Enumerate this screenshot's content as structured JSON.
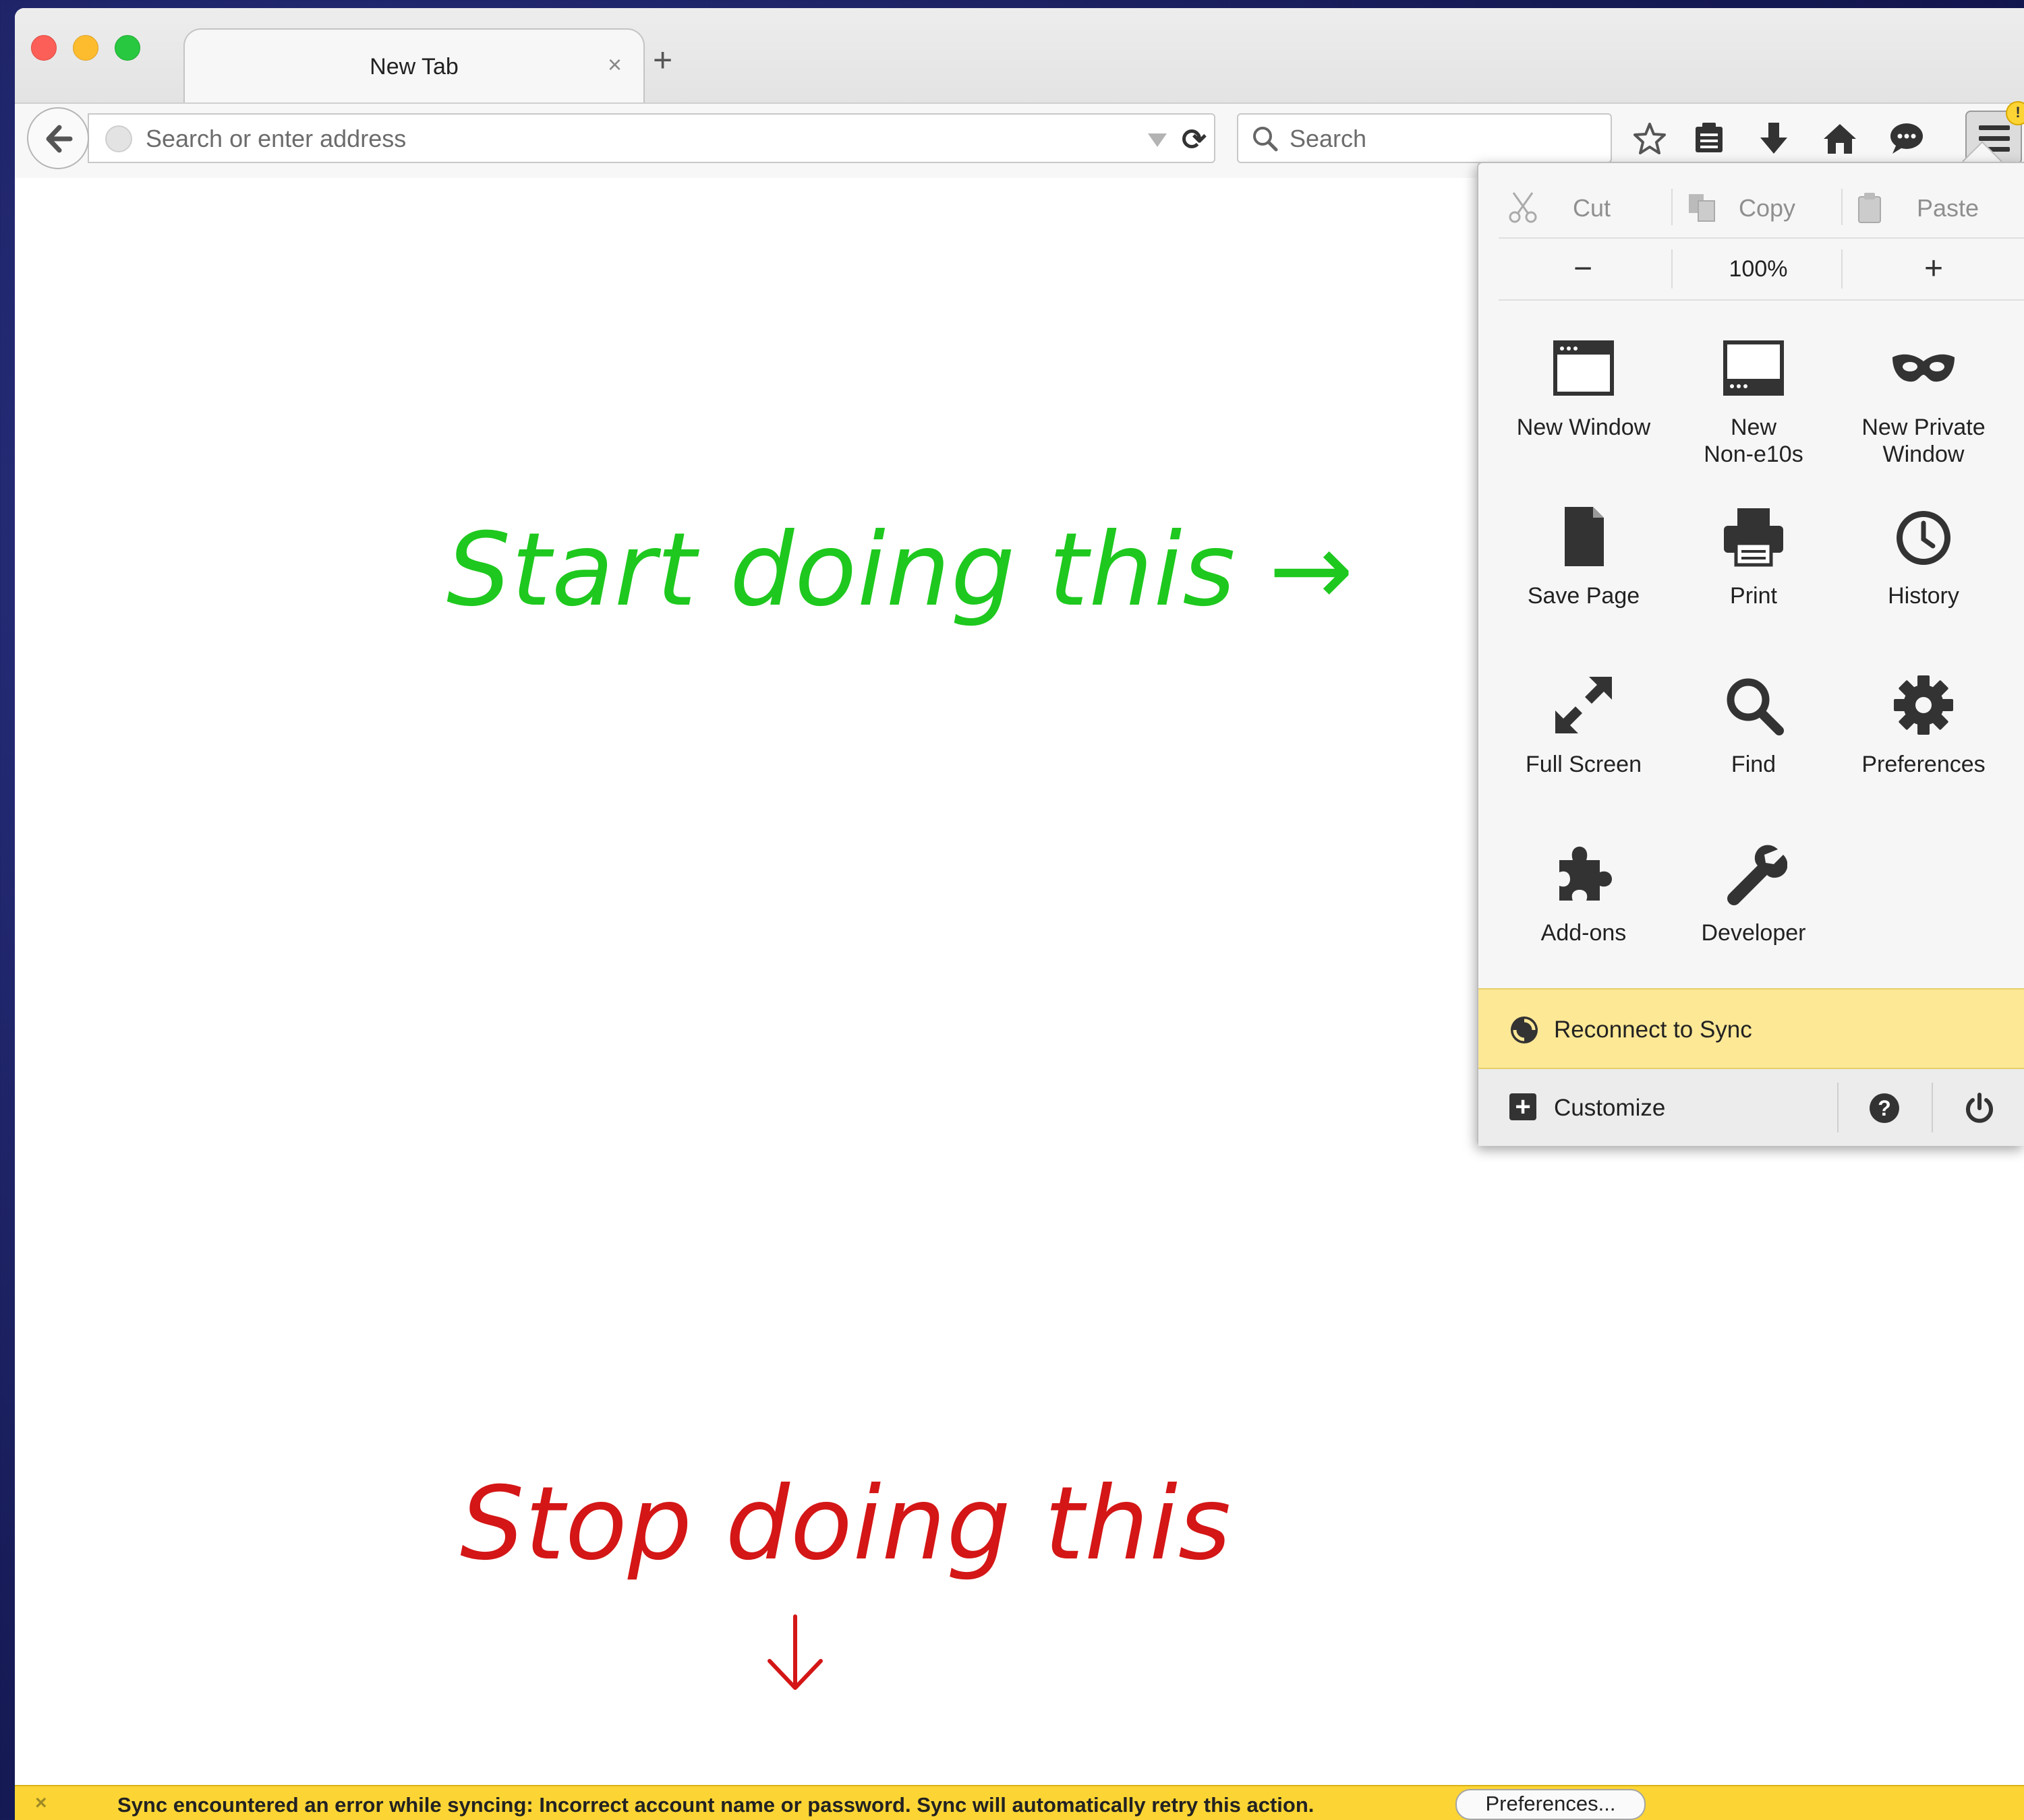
{
  "tab": {
    "title": "New Tab",
    "close_glyph": "×",
    "new_tab_glyph": "+"
  },
  "navbar": {
    "url_placeholder": "Search or enter address",
    "search_placeholder": "Search",
    "toolbar_icons": [
      "bookmark-star-icon",
      "reading-list-icon",
      "download-icon",
      "home-icon",
      "chat-icon"
    ]
  },
  "menu": {
    "edit": {
      "cut": "Cut",
      "copy": "Copy",
      "paste": "Paste"
    },
    "zoom": {
      "minus": "−",
      "value": "100%",
      "plus": "+"
    },
    "items": [
      {
        "label": "New Window",
        "icon": "new-window-icon"
      },
      {
        "label": "New\nNon-e10s",
        "icon": "non-e10s-window-icon"
      },
      {
        "label": "New Private\nWindow",
        "icon": "private-mask-icon"
      },
      {
        "label": "Save Page",
        "icon": "save-page-icon"
      },
      {
        "label": "Print",
        "icon": "printer-icon"
      },
      {
        "label": "History",
        "icon": "clock-icon"
      },
      {
        "label": "Full Screen",
        "icon": "fullscreen-arrows-icon"
      },
      {
        "label": "Find",
        "icon": "magnifier-icon"
      },
      {
        "label": "Preferences",
        "icon": "gear-icon"
      },
      {
        "label": "Add-ons",
        "icon": "puzzle-icon"
      },
      {
        "label": "Developer",
        "icon": "wrench-icon"
      }
    ],
    "sync_label": "Reconnect to Sync",
    "customize_label": "Customize",
    "badge": "!"
  },
  "content": {
    "start_text": "Start doing this →",
    "stop_text": "Stop doing this",
    "start_color": "#1ec81e",
    "stop_color": "#d41616"
  },
  "notification": {
    "close_glyph": "×",
    "message": "Sync encountered an error while syncing: Incorrect account name or password. Sync will automatically retry this action.",
    "button_label": "Preferences..."
  }
}
